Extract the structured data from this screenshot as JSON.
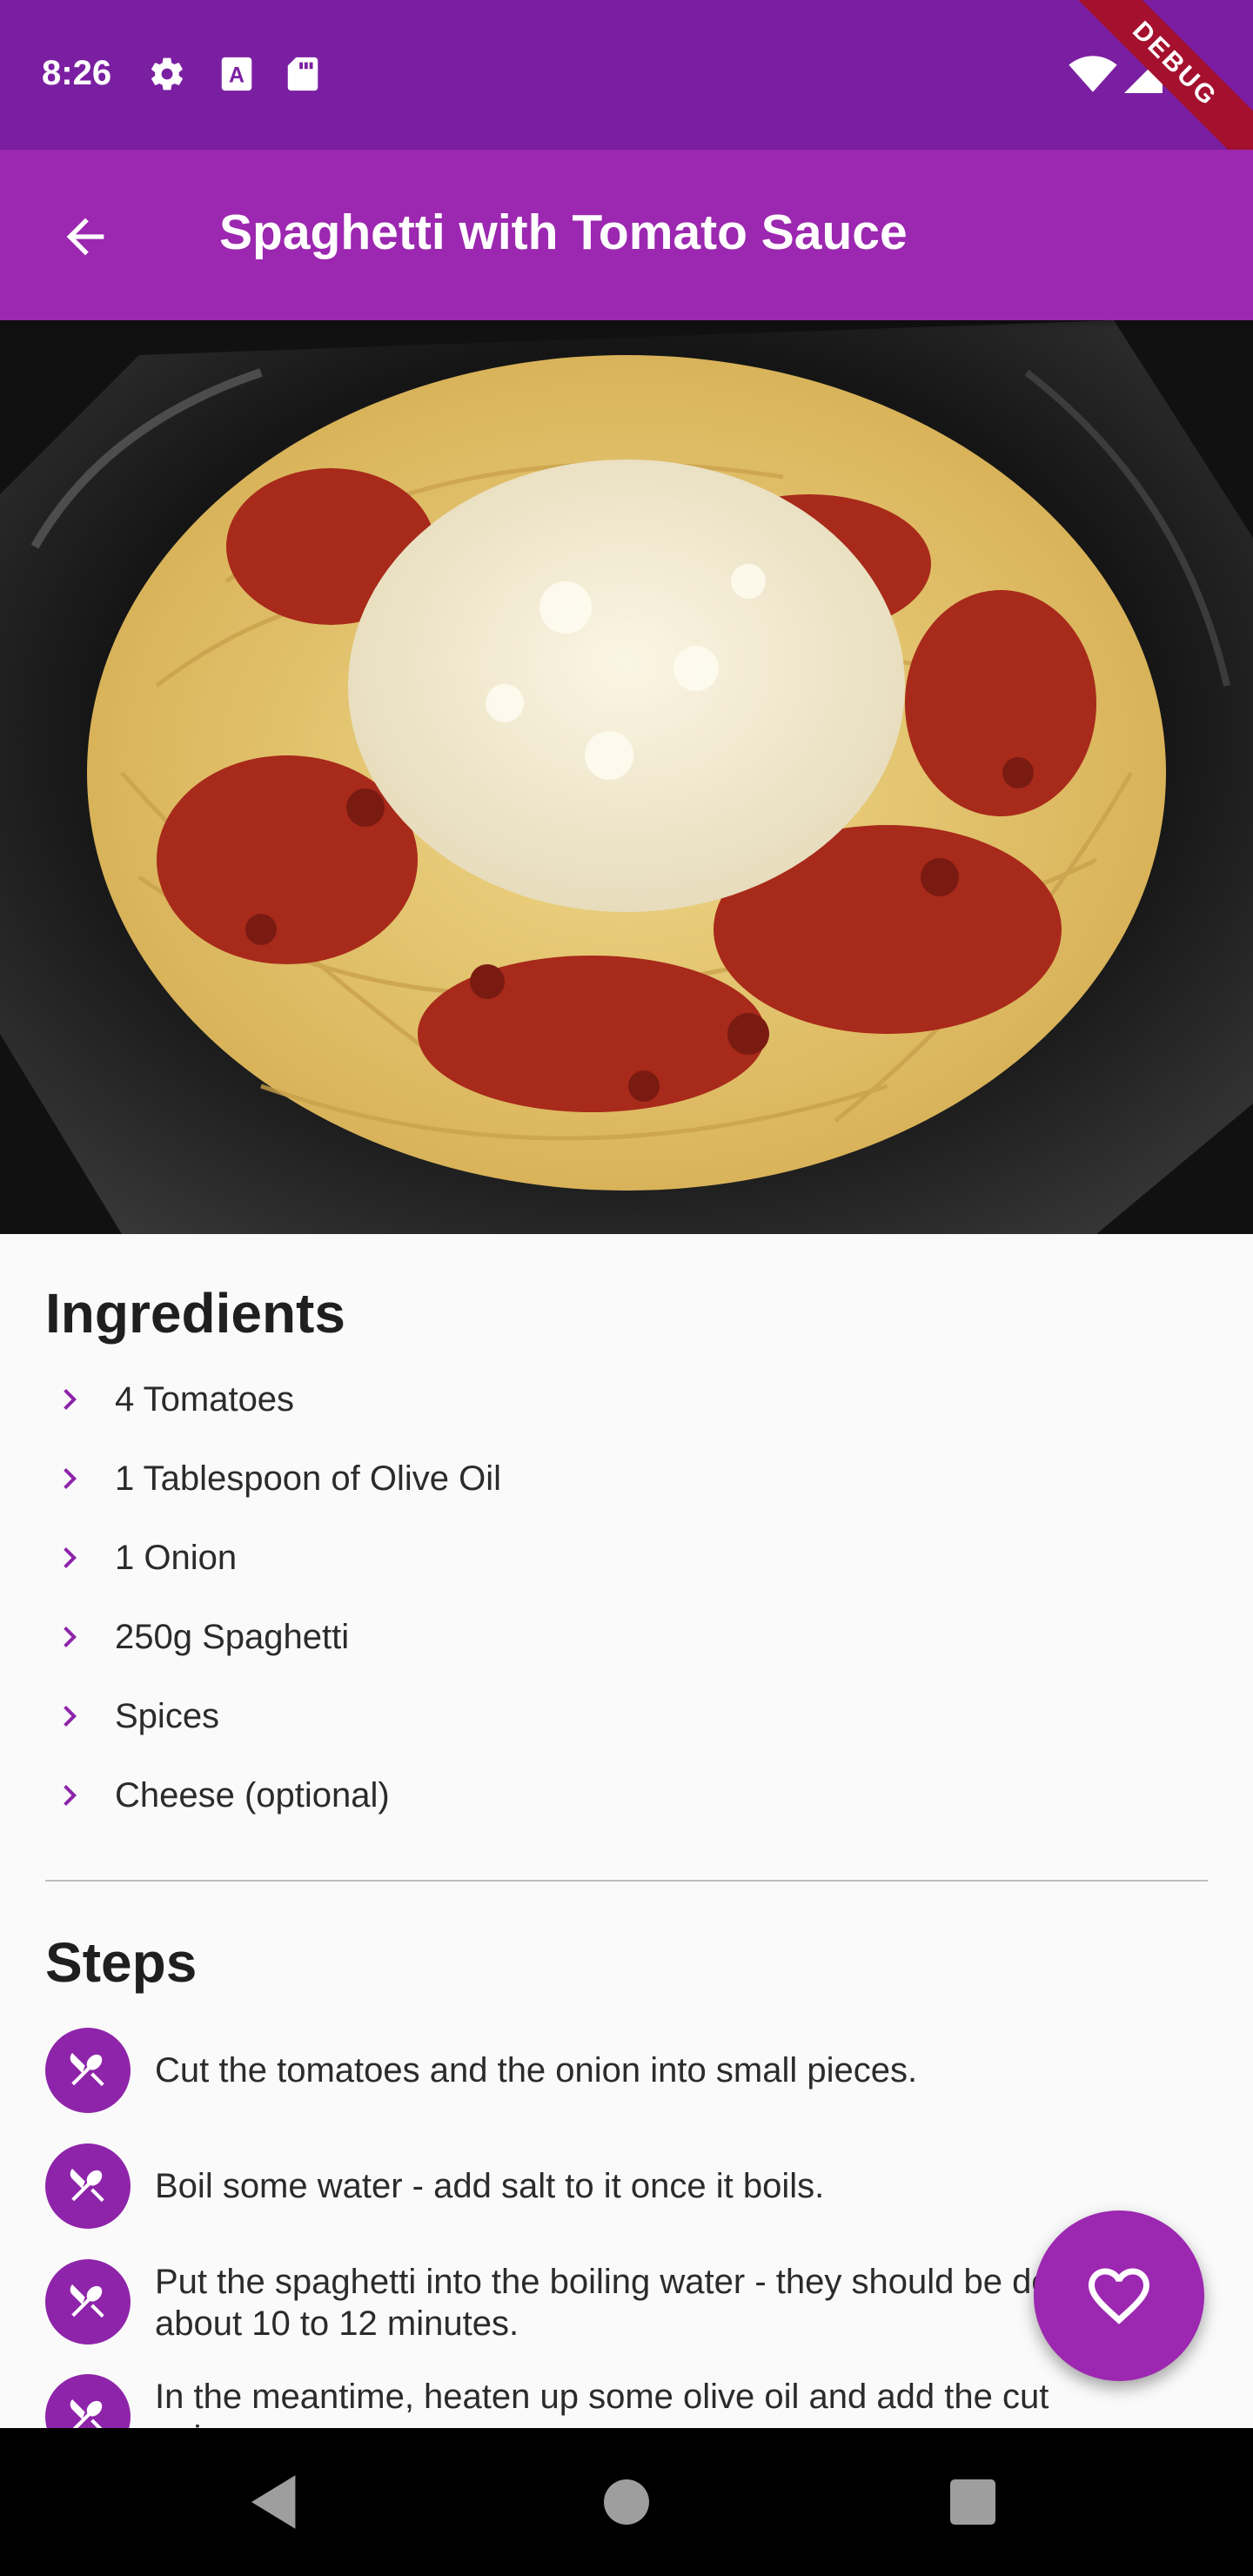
{
  "status_bar": {
    "time": "8:26",
    "debug_label": "DEBUG",
    "icons": [
      "settings-icon",
      "a-text-icon",
      "sd-card-icon",
      "wifi-icon",
      "signal-icon",
      "battery-icon"
    ]
  },
  "app_bar": {
    "title": "Spaghetti with Tomato Sauce",
    "back_icon": "arrow-back-icon"
  },
  "hero_image": {
    "subject": "spaghetti-with-tomato-sauce-photo"
  },
  "ingredients": {
    "title": "Ingredients",
    "items": [
      "4 Tomatoes",
      "1 Tablespoon of Olive Oil",
      "1 Onion",
      "250g Spaghetti",
      "Spices",
      "Cheese (optional)"
    ]
  },
  "steps": {
    "title": "Steps",
    "items": [
      "Cut the tomatoes and the onion into small pieces.",
      "Boil some water - add salt to it once it boils.",
      "Put the spaghetti into the boiling water - they should be done in about 10 to 12 minutes.",
      "In the meantime, heaten up some olive oil and add the cut onion."
    ]
  },
  "fab": {
    "icon": "favorite-border-icon"
  },
  "colors": {
    "status_bar": "#7b1fa2",
    "primary": "#9c27b0",
    "accent": "#8e24aa",
    "background": "#fafafa"
  }
}
